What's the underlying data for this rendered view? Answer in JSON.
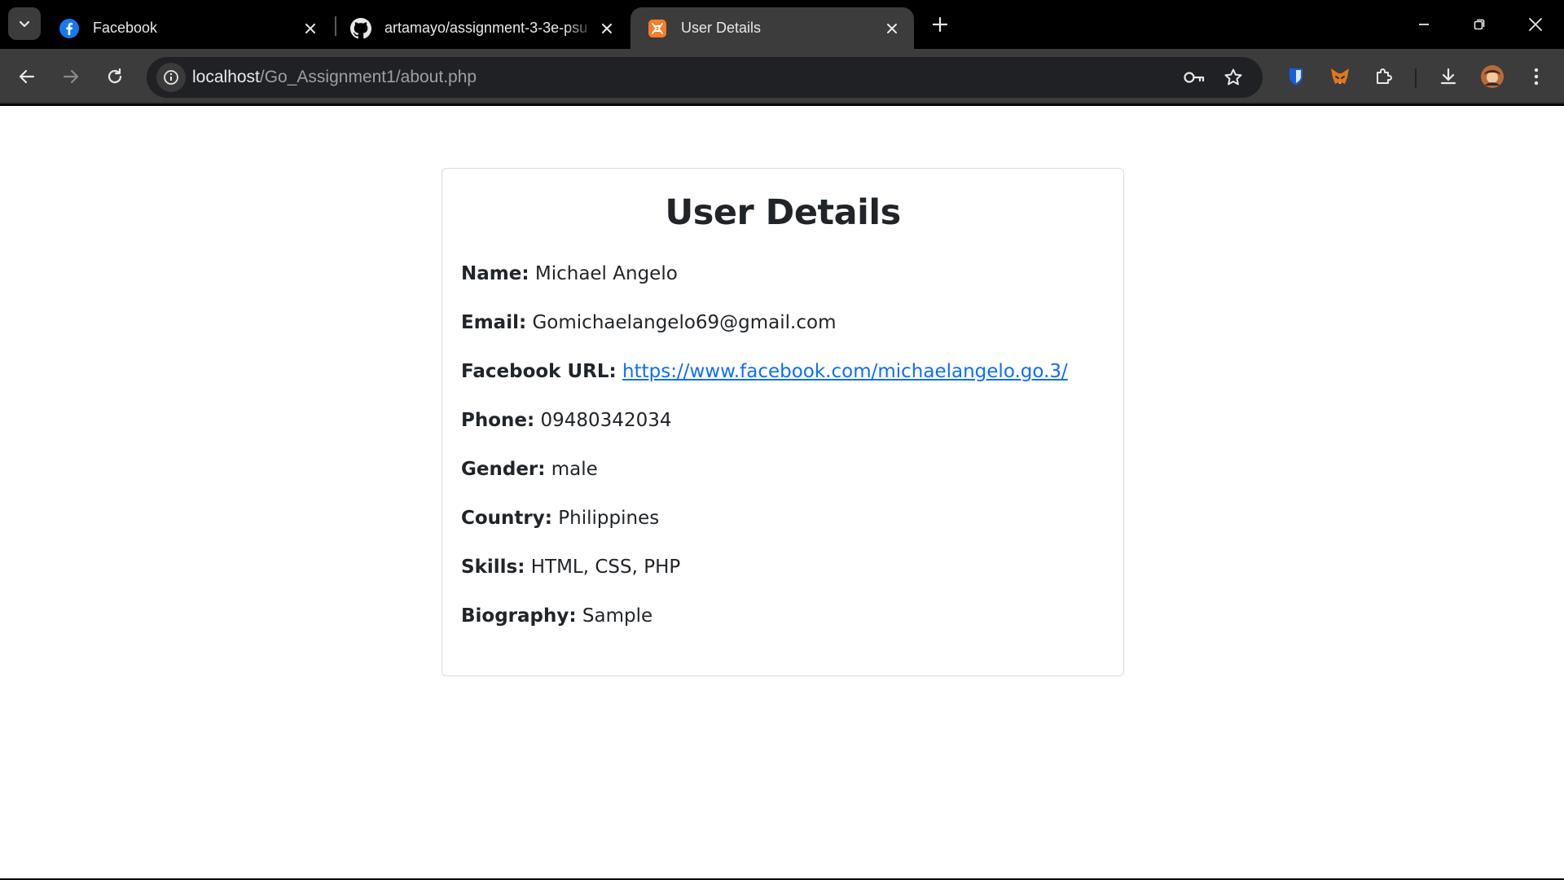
{
  "browser": {
    "tabs": [
      {
        "title": "Facebook"
      },
      {
        "title": "artamayo/assignment-3-3e-psu"
      },
      {
        "title": "User Details"
      }
    ],
    "url_host": "localhost",
    "url_path": "/Go_Assignment1/about.php"
  },
  "page": {
    "heading": "User Details",
    "fields": [
      {
        "label": "Name:",
        "value": "Michael Angelo"
      },
      {
        "label": "Email:",
        "value": "Gomichaelangelo69@gmail.com"
      },
      {
        "label": "Facebook URL:",
        "value": "https://www.facebook.com/michaelangelo.go.3/"
      },
      {
        "label": "Phone:",
        "value": "09480342034"
      },
      {
        "label": "Gender:",
        "value": "male"
      },
      {
        "label": "Country:",
        "value": "Philippines"
      },
      {
        "label": "Skills:",
        "value": "HTML, CSS, PHP"
      },
      {
        "label": "Biography:",
        "value": "Sample"
      }
    ]
  },
  "colors": {
    "link": "#0d6efd",
    "active_tab": "#3c3c3c",
    "toolbar": "#3c3c3c"
  }
}
